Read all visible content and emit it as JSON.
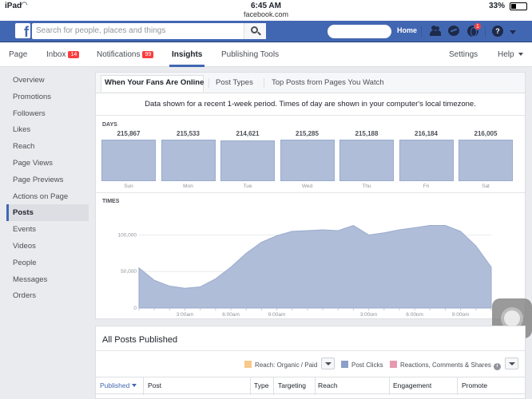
{
  "status_bar": {
    "device": "iPad",
    "time": "6:45 AM",
    "url": "facebook.com",
    "battery": "33%"
  },
  "top_nav": {
    "search_placeholder": "Search for people, places and things",
    "home_label": "Home",
    "notifications_badge": "1"
  },
  "page_tabs": {
    "page": "Page",
    "inbox": "Inbox",
    "inbox_count": "14",
    "notifications": "Notifications",
    "notifications_count": "99",
    "insights": "Insights",
    "publishing_tools": "Publishing Tools",
    "settings": "Settings",
    "help": "Help"
  },
  "sidebar": {
    "items": [
      {
        "label": "Overview"
      },
      {
        "label": "Promotions"
      },
      {
        "label": "Followers"
      },
      {
        "label": "Likes"
      },
      {
        "label": "Reach"
      },
      {
        "label": "Page Views"
      },
      {
        "label": "Page Previews"
      },
      {
        "label": "Actions on Page"
      },
      {
        "label": "Posts"
      },
      {
        "label": "Events"
      },
      {
        "label": "Videos"
      },
      {
        "label": "People"
      },
      {
        "label": "Messages"
      },
      {
        "label": "Orders"
      }
    ],
    "active": "Posts"
  },
  "subtabs": [
    "When Your Fans Are Online",
    "Post Types",
    "Top Posts from Pages You Watch"
  ],
  "notice": "Data shown for a recent 1-week period. Times of day are shown in your computer's local timezone.",
  "days_label": "DAYS",
  "times_label": "TIMES",
  "chart_data": [
    {
      "type": "bar",
      "title": "DAYS",
      "categories": [
        "Sun",
        "Mon",
        "Tue",
        "Wed",
        "Thu",
        "Fri",
        "Sat"
      ],
      "values": [
        215867,
        215533,
        214621,
        215285,
        215188,
        216184,
        216005
      ],
      "value_labels": [
        "215,867",
        "215,533",
        "214,621",
        "215,285",
        "215,188",
        "216,184",
        "216,005"
      ],
      "color": "#afbdd8"
    },
    {
      "type": "area",
      "title": "TIMES",
      "x": [
        0,
        1,
        2,
        3,
        4,
        5,
        6,
        7,
        8,
        9,
        10,
        11,
        12,
        13,
        14,
        15,
        16,
        17,
        18,
        19,
        20,
        21,
        22,
        23
      ],
      "x_tick_labels": [
        {
          "x": 3,
          "label": "3:00am"
        },
        {
          "x": 6,
          "label": "6:00am"
        },
        {
          "x": 9,
          "label": "9:00am"
        },
        {
          "x": 15,
          "label": "3:00pm"
        },
        {
          "x": 18,
          "label": "6:00pm"
        },
        {
          "x": 21,
          "label": "9:00pm"
        }
      ],
      "values": [
        55000,
        38000,
        30000,
        27000,
        29000,
        40000,
        56000,
        75000,
        90000,
        99000,
        105000,
        106000,
        107000,
        106000,
        113000,
        100000,
        103000,
        107000,
        110000,
        113000,
        113000,
        105000,
        85000,
        56000
      ],
      "y_ticks": [
        0,
        50000,
        100000
      ],
      "y_tick_labels": [
        "0",
        "50,000",
        "100,000"
      ],
      "ylim": [
        0,
        130000
      ],
      "grid": true,
      "color": "#afbdd8"
    }
  ],
  "posts": {
    "title": "All Posts Published",
    "legend": [
      "Reach: Organic / Paid",
      "Post Clicks",
      "Reactions, Comments & Shares"
    ],
    "legend_colors": [
      "#f7c98b",
      "#8d9fc8",
      "#e59ab0"
    ],
    "columns": [
      "Published",
      "Post",
      "Type",
      "Targeting",
      "Reach",
      "Engagement",
      "Promote"
    ]
  }
}
